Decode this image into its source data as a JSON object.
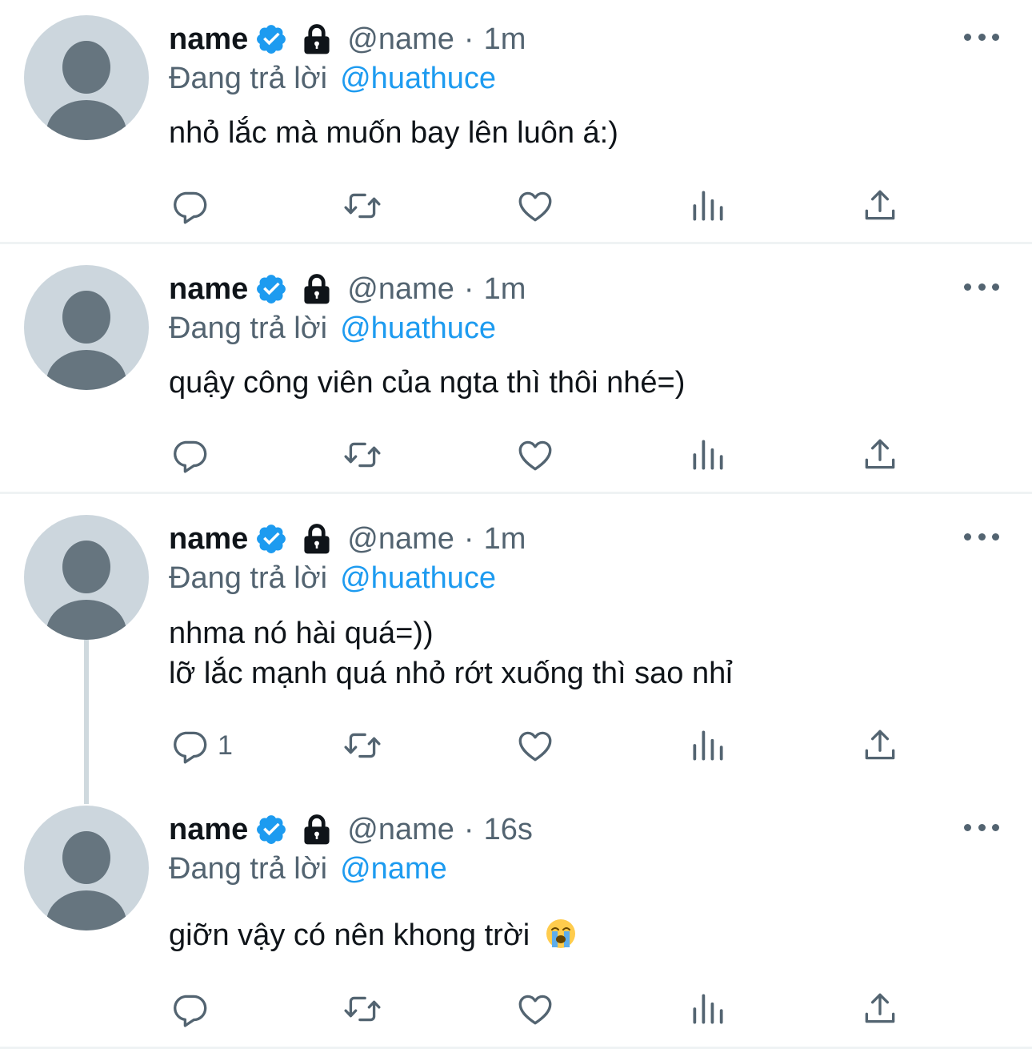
{
  "tweets": [
    {
      "name": "name",
      "handle": "@name",
      "separator": "·",
      "time": "1m",
      "reply_prefix": "Đang trả lời",
      "reply_to": "@huathuce",
      "lines": [
        "nhỏ lắc mà muốn bay lên luôn á:)"
      ],
      "reply_count": ""
    },
    {
      "name": "name",
      "handle": "@name",
      "separator": "·",
      "time": "1m",
      "reply_prefix": "Đang trả lời",
      "reply_to": "@huathuce",
      "lines": [
        "quậy công viên của ngta thì thôi nhé=)"
      ],
      "reply_count": ""
    },
    {
      "name": "name",
      "handle": "@name",
      "separator": "·",
      "time": "1m",
      "reply_prefix": "Đang trả lời",
      "reply_to": "@huathuce",
      "lines": [
        "nhma nó hài quá=))",
        "lỡ lắc mạnh quá nhỏ rớt xuống thì sao nhỉ"
      ],
      "reply_count": "1"
    },
    {
      "name": "name",
      "handle": "@name",
      "separator": "·",
      "time": "16s",
      "reply_prefix": "Đang trả lời",
      "reply_to": "@name",
      "lines": [
        "giỡn vậy có nên khong trời"
      ],
      "emoji": "loudly-crying-face",
      "reply_count": ""
    }
  ],
  "icons": {
    "verified": "verified-badge-icon",
    "lock": "lock-icon",
    "more": "more-icon",
    "reply": "reply-icon",
    "retweet": "retweet-icon",
    "like": "like-icon",
    "views": "views-icon",
    "share": "share-icon"
  },
  "colors": {
    "accent": "#1d9bf0",
    "secondary_text": "#536471",
    "primary_text": "#0f1419",
    "avatar_bg": "#ccd6dd",
    "avatar_fg": "#66757f"
  }
}
